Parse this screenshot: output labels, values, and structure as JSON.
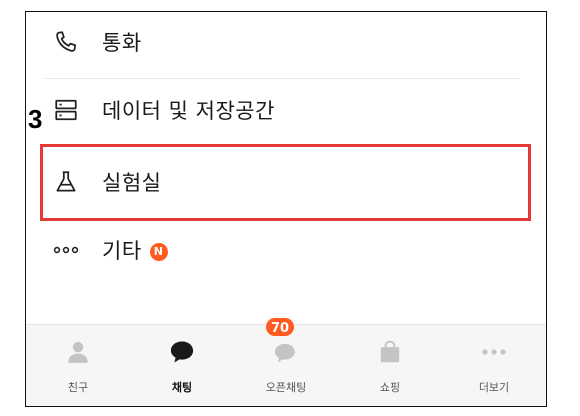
{
  "menu": {
    "call_label": "통화",
    "data_label": "데이터 및 저장공간",
    "lab_label": "실험실",
    "etc_label": "기타",
    "etc_new_badge": "N"
  },
  "annotation": {
    "step_number": "3",
    "highlight_color": "#e53935"
  },
  "tabs": [
    {
      "label": "친구",
      "icon": "person-icon",
      "active": false
    },
    {
      "label": "채팅",
      "icon": "chat-bubble-icon",
      "active": true
    },
    {
      "label": "오픈채팅",
      "icon": "open-chat-icon",
      "active": false,
      "badge": "70"
    },
    {
      "label": "쇼핑",
      "icon": "shopping-bag-icon",
      "active": false
    },
    {
      "label": "더보기",
      "icon": "more-dots-icon",
      "active": false
    }
  ],
  "colors": {
    "badge": "#ff5a1f",
    "tabbar_bg": "#f6f6f6",
    "icon_inactive": "#c4c4c4",
    "icon_active": "#1a1a1a"
  }
}
